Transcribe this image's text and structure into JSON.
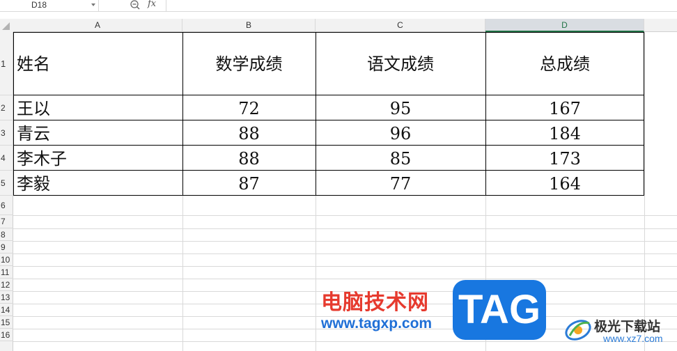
{
  "formula_bar": {
    "name_box": "D18",
    "fx_label": "fx",
    "formula": ""
  },
  "columns": [
    "A",
    "B",
    "C",
    "D"
  ],
  "selected_column": "D",
  "rows": [
    "1",
    "2",
    "3",
    "4",
    "5",
    "6",
    "7",
    "8",
    "9",
    "10",
    "11",
    "12",
    "13",
    "14",
    "15",
    "16"
  ],
  "table": {
    "headers": [
      "姓名",
      "数学成绩",
      "语文成绩",
      "总成绩"
    ],
    "data": [
      {
        "name": "王以",
        "math": "72",
        "chinese": "95",
        "total": "167"
      },
      {
        "name": "青云",
        "math": "88",
        "chinese": "96",
        "total": "184"
      },
      {
        "name": "李木子",
        "math": "88",
        "chinese": "85",
        "total": "173"
      },
      {
        "name": "李毅",
        "math": "87",
        "chinese": "77",
        "total": "164"
      }
    ]
  },
  "watermark": {
    "title": "电脑技术网",
    "url": "www.tagxp.com",
    "tag": "TAG",
    "brand": "极光下载站",
    "brand_url": "www.xz7.com"
  },
  "colors": {
    "selected_header": "#217346",
    "watermark_red": "#e63a2e",
    "watermark_blue": "#1877e0"
  }
}
